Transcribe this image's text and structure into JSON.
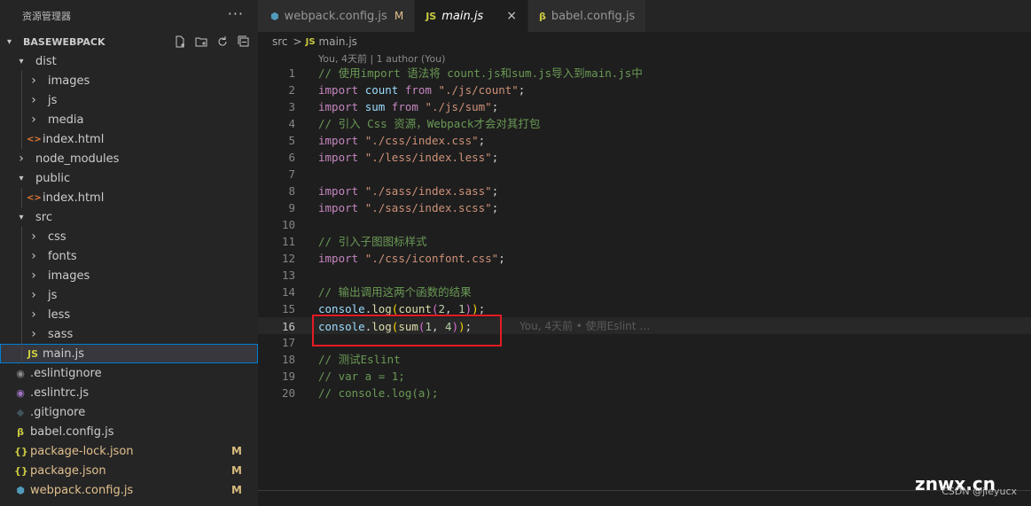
{
  "sidebar": {
    "title": "资源管理器",
    "more": "···",
    "project": "BASEWEBPACK",
    "tree": [
      {
        "label": "dist",
        "kind": "folder-open",
        "depth": 1
      },
      {
        "label": "images",
        "kind": "folder",
        "depth": 2
      },
      {
        "label": "js",
        "kind": "folder",
        "depth": 2
      },
      {
        "label": "media",
        "kind": "folder",
        "depth": 2
      },
      {
        "label": "index.html",
        "kind": "html",
        "depth": 2
      },
      {
        "label": "node_modules",
        "kind": "folder",
        "depth": 1
      },
      {
        "label": "public",
        "kind": "folder-open",
        "depth": 1
      },
      {
        "label": "index.html",
        "kind": "html",
        "depth": 2
      },
      {
        "label": "src",
        "kind": "folder-open",
        "depth": 1
      },
      {
        "label": "css",
        "kind": "folder",
        "depth": 2
      },
      {
        "label": "fonts",
        "kind": "folder",
        "depth": 2
      },
      {
        "label": "images",
        "kind": "folder",
        "depth": 2
      },
      {
        "label": "js",
        "kind": "folder",
        "depth": 2
      },
      {
        "label": "less",
        "kind": "folder",
        "depth": 2
      },
      {
        "label": "sass",
        "kind": "folder",
        "depth": 2
      },
      {
        "label": "main.js",
        "kind": "js",
        "depth": 2,
        "selected": true
      },
      {
        "label": ".eslintignore",
        "kind": "eslint",
        "depth": 1
      },
      {
        "label": ".eslintrc.js",
        "kind": "eslintrc",
        "depth": 1
      },
      {
        "label": ".gitignore",
        "kind": "git",
        "depth": 1
      },
      {
        "label": "babel.config.js",
        "kind": "babel",
        "depth": 1
      },
      {
        "label": "package-lock.json",
        "kind": "json",
        "depth": 1,
        "badge": "M"
      },
      {
        "label": "package.json",
        "kind": "json",
        "depth": 1,
        "badge": "M"
      },
      {
        "label": "webpack.config.js",
        "kind": "webpack",
        "depth": 1,
        "badge": "M"
      }
    ]
  },
  "tabs": [
    {
      "label": "webpack.config.js",
      "icon": "webpack-icon",
      "mod": "M"
    },
    {
      "label": "main.js",
      "icon": "js-icon",
      "active": true,
      "close": "×"
    },
    {
      "label": "babel.config.js",
      "icon": "babel-icon"
    }
  ],
  "breadcrumb": {
    "folder": "src",
    "sep": ">",
    "file_icon": "JS",
    "file": "main.js"
  },
  "blame_top": "You, 4天前 | 1 author (You)",
  "code_lines": [
    [
      [
        "c",
        "// 使用import 语法将 count.js和sum.js导入到main.js中"
      ]
    ],
    [
      [
        "k",
        "import "
      ],
      [
        "v",
        "count "
      ],
      [
        "k",
        "from "
      ],
      [
        "s",
        "\"./js/count\""
      ],
      [
        "d",
        ";"
      ]
    ],
    [
      [
        "k",
        "import "
      ],
      [
        "v",
        "sum "
      ],
      [
        "k",
        "from "
      ],
      [
        "s",
        "\"./js/sum\""
      ],
      [
        "d",
        ";"
      ]
    ],
    [
      [
        "c",
        "// 引入 Css 资源，Webpack才会对其打包"
      ]
    ],
    [
      [
        "k",
        "import "
      ],
      [
        "s",
        "\"./css/index.css\""
      ],
      [
        "d",
        ";"
      ]
    ],
    [
      [
        "k",
        "import "
      ],
      [
        "s",
        "\"./less/index.less\""
      ],
      [
        "d",
        ";"
      ]
    ],
    [],
    [
      [
        "k",
        "import "
      ],
      [
        "s",
        "\"./sass/index.sass\""
      ],
      [
        "d",
        ";"
      ]
    ],
    [
      [
        "k",
        "import "
      ],
      [
        "s",
        "\"./sass/index.scss\""
      ],
      [
        "d",
        ";"
      ]
    ],
    [],
    [
      [
        "c",
        "// 引入子图图标样式"
      ]
    ],
    [
      [
        "k",
        "import "
      ],
      [
        "s",
        "\"./css/iconfont.css\""
      ],
      [
        "d",
        ";"
      ]
    ],
    [],
    [
      [
        "c",
        "// 输出调用这两个函数的结果"
      ]
    ],
    [
      [
        "v",
        "console"
      ],
      [
        "d",
        "."
      ],
      [
        "f",
        "log"
      ],
      [
        "p1",
        "("
      ],
      [
        "f",
        "count"
      ],
      [
        "p2",
        "("
      ],
      [
        "n",
        "2"
      ],
      [
        "d",
        ", "
      ],
      [
        "n",
        "1"
      ],
      [
        "p2",
        ")"
      ],
      [
        "p1",
        ")"
      ],
      [
        "d",
        ";"
      ]
    ],
    [
      [
        "v",
        "console"
      ],
      [
        "d",
        "."
      ],
      [
        "f",
        "log"
      ],
      [
        "p1",
        "("
      ],
      [
        "f",
        "sum"
      ],
      [
        "p2",
        "("
      ],
      [
        "n",
        "1"
      ],
      [
        "d",
        ", "
      ],
      [
        "n",
        "4"
      ],
      [
        "p2",
        ")"
      ],
      [
        "p1",
        ")"
      ],
      [
        "d",
        ";"
      ]
    ],
    [],
    [
      [
        "c",
        "// 测试Eslint"
      ]
    ],
    [
      [
        "c",
        "// var a = 1;"
      ]
    ],
    [
      [
        "c",
        "// console.log(a);"
      ]
    ]
  ],
  "current_line": 16,
  "inline_blame": "You, 4天前 • 使用Eslint …",
  "watermark": "znwx.cn",
  "watermark_sub": "CSDN @jieyucx",
  "colors": {
    "accent": "#007fd4",
    "highlight_box": "#e51b24",
    "modified": "#e2c08d"
  }
}
